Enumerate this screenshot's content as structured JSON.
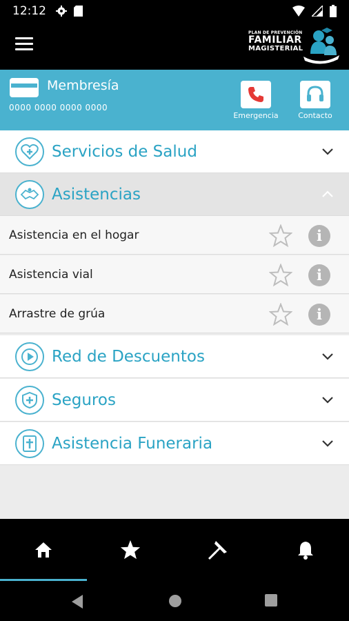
{
  "status_bar": {
    "time": "12:12"
  },
  "app": {
    "logo": {
      "line1": "PLAN DE PREVENCIÓN",
      "line2": "FAMILIAR",
      "line3": "MAGISTERIAL"
    }
  },
  "membership": {
    "title": "Membresía",
    "number": "0000 0000 0000 0000",
    "emergency_label": "Emergencia",
    "contact_label": "Contacto"
  },
  "sections": [
    {
      "name": "Servicios de Salud",
      "expanded": false
    },
    {
      "name": "Asistencias",
      "expanded": true,
      "items": [
        {
          "label": "Asistencia en el hogar"
        },
        {
          "label": "Asistencia vial"
        },
        {
          "label": "Arrastre de grúa"
        }
      ]
    },
    {
      "name": "Red de Descuentos",
      "expanded": false
    },
    {
      "name": "Seguros",
      "expanded": false
    },
    {
      "name": "Asistencia Funeraria",
      "expanded": false
    }
  ],
  "bottom_nav": {
    "items": [
      "home-icon",
      "star-icon",
      "pin-icon",
      "bell-icon"
    ],
    "active": 0
  },
  "colors": {
    "accent": "#4ab2cf",
    "accent_text": "#2aa3c4",
    "emergency_red": "#e53935"
  }
}
